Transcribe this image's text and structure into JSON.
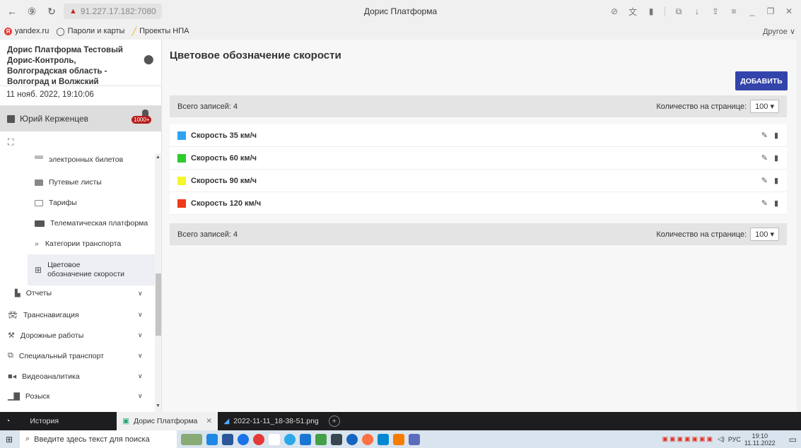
{
  "browser": {
    "url_warning_icon": "warning-icon",
    "url": "91.227.17.182:7080",
    "page_title": "Дорис Платформа",
    "bookmarks": [
      {
        "label": "yandex.ru",
        "icon": "yandex-icon"
      },
      {
        "label": "Пароли и карты",
        "icon": "key-icon"
      },
      {
        "label": "Проекты НПА",
        "icon": "folder-icon"
      }
    ],
    "bookmarks_other": "Другое ∨"
  },
  "sidebar": {
    "org_name": "Дорис Платформа Тестовый Дорис-Контроль, Волгоградская область - Волгоград и Волжский",
    "datetime": "11 нояб. 2022, 19:10:06",
    "user_name": "Юрий Керженцев",
    "notifications_badge": "1000+",
    "items": [
      {
        "label": "электронных билетов",
        "icon": "ticket-icon",
        "indent": true,
        "chevron": ""
      },
      {
        "label": "Путевые листы",
        "icon": "list-icon",
        "indent": true,
        "chevron": ""
      },
      {
        "label": "Тарифы",
        "icon": "tariff-icon",
        "indent": true,
        "chevron": ""
      },
      {
        "label": "Телематическая платформа",
        "icon": "telematics-icon",
        "indent": true,
        "chevron": ""
      },
      {
        "label": "Категории транспорта",
        "icon": "chevrons-right-icon",
        "indent": true,
        "chevron": ""
      },
      {
        "label": "Цветовое обозначение скорости",
        "icon": "palette-icon",
        "indent": true,
        "chevron": "",
        "active": true
      },
      {
        "label": "Отчеты",
        "icon": "chart-icon",
        "indent": false,
        "chevron": "∨"
      },
      {
        "label": "Транснавигация",
        "icon": "car-icon",
        "indent": false,
        "chevron": "∨"
      },
      {
        "label": "Дорожные работы",
        "icon": "roadwork-icon",
        "indent": false,
        "chevron": "∨"
      },
      {
        "label": "Специальный транспорт",
        "icon": "special-transport-icon",
        "indent": false,
        "chevron": "∨"
      },
      {
        "label": "Видеоаналитика",
        "icon": "video-icon",
        "indent": false,
        "chevron": "∨"
      },
      {
        "label": "Розыск",
        "icon": "search-person-icon",
        "indent": false,
        "chevron": "∨"
      }
    ]
  },
  "main": {
    "title": "Цветовое обозначение скорости",
    "add_button": "ДОБАВИТЬ",
    "total_label": "Всего записей: 4",
    "per_page_label": "Количество на странице:",
    "per_page_value": "100 ▾",
    "rows": [
      {
        "label": "Скорость 35 км/ч",
        "color": "#2ea3f2"
      },
      {
        "label": "Скорость 60 км/ч",
        "color": "#2ecc2e"
      },
      {
        "label": "Скорость 90 км/ч",
        "color": "#f5f52a"
      },
      {
        "label": "Скорость 120 км/ч",
        "color": "#f03a1a"
      }
    ]
  },
  "tabs": {
    "history": "История",
    "tab1": "Дорис Платформа",
    "tab2": "2022-11-11_18-38-51.png"
  },
  "taskbar": {
    "search_placeholder": "Введите здесь текст для поиска",
    "lang": "РУС",
    "time": "19:10",
    "date": "11.11.2022"
  }
}
